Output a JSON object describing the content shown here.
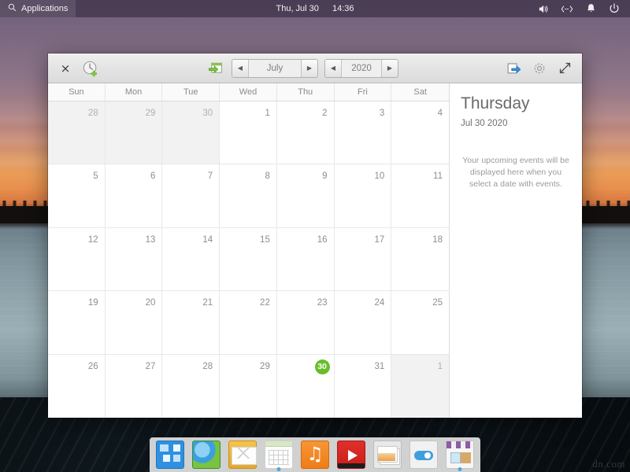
{
  "top_panel": {
    "applications_label": "Applications",
    "search_icon": "search-icon",
    "clock_date": "Thu, Jul 30",
    "clock_time": "14:36",
    "tray": [
      {
        "name": "volume-icon",
        "glyph": "volume"
      },
      {
        "name": "network-icon",
        "glyph": "network"
      },
      {
        "name": "notifications-icon",
        "glyph": "bell"
      },
      {
        "name": "power-icon",
        "glyph": "power"
      }
    ]
  },
  "window": {
    "close_label": "×",
    "toolbar": {
      "add_event_icon": "add-event-icon",
      "go_to_today_icon": "go-to-today-icon",
      "export_icon": "export-icon",
      "preferences_icon": "gear-icon",
      "fullscreen_icon": "fullscreen-icon",
      "month_prev": "◀",
      "month_value": "July",
      "month_next": "▶",
      "year_prev": "◀",
      "year_value": "2020",
      "year_next": "▶"
    },
    "weekdays": [
      "Sun",
      "Mon",
      "Tue",
      "Wed",
      "Thu",
      "Fri",
      "Sat"
    ],
    "weeks": [
      [
        {
          "n": "28",
          "other": true,
          "today": false
        },
        {
          "n": "29",
          "other": true,
          "today": false
        },
        {
          "n": "30",
          "other": true,
          "today": false
        },
        {
          "n": "1",
          "other": false,
          "today": false
        },
        {
          "n": "2",
          "other": false,
          "today": false
        },
        {
          "n": "3",
          "other": false,
          "today": false
        },
        {
          "n": "4",
          "other": false,
          "today": false
        }
      ],
      [
        {
          "n": "5",
          "other": false,
          "today": false
        },
        {
          "n": "6",
          "other": false,
          "today": false
        },
        {
          "n": "7",
          "other": false,
          "today": false
        },
        {
          "n": "8",
          "other": false,
          "today": false
        },
        {
          "n": "9",
          "other": false,
          "today": false
        },
        {
          "n": "10",
          "other": false,
          "today": false
        },
        {
          "n": "11",
          "other": false,
          "today": false
        }
      ],
      [
        {
          "n": "12",
          "other": false,
          "today": false
        },
        {
          "n": "13",
          "other": false,
          "today": false
        },
        {
          "n": "14",
          "other": false,
          "today": false
        },
        {
          "n": "15",
          "other": false,
          "today": false
        },
        {
          "n": "16",
          "other": false,
          "today": false
        },
        {
          "n": "17",
          "other": false,
          "today": false
        },
        {
          "n": "18",
          "other": false,
          "today": false
        }
      ],
      [
        {
          "n": "19",
          "other": false,
          "today": false
        },
        {
          "n": "20",
          "other": false,
          "today": false
        },
        {
          "n": "21",
          "other": false,
          "today": false
        },
        {
          "n": "22",
          "other": false,
          "today": false
        },
        {
          "n": "23",
          "other": false,
          "today": false
        },
        {
          "n": "24",
          "other": false,
          "today": false
        },
        {
          "n": "25",
          "other": false,
          "today": false
        }
      ],
      [
        {
          "n": "26",
          "other": false,
          "today": false
        },
        {
          "n": "27",
          "other": false,
          "today": false
        },
        {
          "n": "28",
          "other": false,
          "today": false
        },
        {
          "n": "29",
          "other": false,
          "today": false
        },
        {
          "n": "30",
          "other": false,
          "today": true
        },
        {
          "n": "31",
          "other": false,
          "today": false
        },
        {
          "n": "1",
          "other": true,
          "today": false
        }
      ]
    ],
    "side_panel": {
      "day_name": "Thursday",
      "date_string": "Jul 30 2020",
      "empty_message": "Your upcoming events will be displayed here when you select a date with events."
    }
  },
  "dock": {
    "items": [
      {
        "name": "dock-item-applications",
        "cls": "ic-apps",
        "label": "Applications",
        "running": false
      },
      {
        "name": "dock-item-web-browser",
        "cls": "ic-web",
        "label": "Web Browser",
        "running": false
      },
      {
        "name": "dock-item-mail",
        "cls": "ic-mail",
        "label": "Mail",
        "running": false
      },
      {
        "name": "dock-item-calendar",
        "cls": "ic-cal",
        "label": "Calendar",
        "running": true
      },
      {
        "name": "dock-item-music",
        "cls": "ic-music",
        "label": "Music",
        "running": false
      },
      {
        "name": "dock-item-video",
        "cls": "ic-video",
        "label": "Video",
        "running": false
      },
      {
        "name": "dock-item-photos",
        "cls": "ic-photos",
        "label": "Photos",
        "running": false
      },
      {
        "name": "dock-item-settings",
        "cls": "ic-settings",
        "label": "Settings",
        "running": false
      },
      {
        "name": "dock-item-software",
        "cls": "ic-store",
        "label": "Software",
        "running": true
      }
    ]
  },
  "desktop": {
    "watermark": "dn.com"
  },
  "colors": {
    "today_green": "#69bd2a",
    "panel_bg": "#342a3e",
    "window_bg": "#f4f4f4",
    "accent_blue": "#2f8fe0"
  }
}
